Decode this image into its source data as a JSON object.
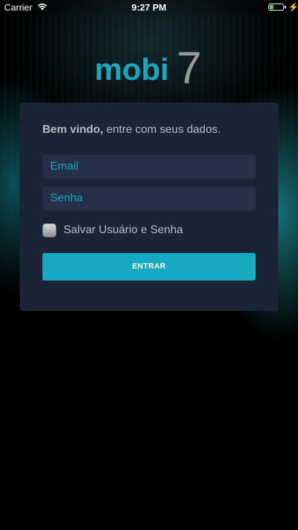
{
  "status_bar": {
    "carrier": "Carrier",
    "time": "9:27 PM",
    "battery_level": 0.3,
    "charging": true
  },
  "brand": {
    "logo_text": "mobi",
    "logo_number": "7",
    "teal_color": "#17a8c2",
    "grey_color": "#9a9a9a"
  },
  "login": {
    "welcome_bold": "Bem vindo,",
    "welcome_rest": " entre com seus dados.",
    "email_placeholder": "Email",
    "password_placeholder": "Senha",
    "remember_label": "Salvar Usuário e Senha",
    "remember_checked": false,
    "submit_label": "ENTRAR"
  },
  "colors": {
    "card_bg": "#1b2437",
    "field_bg": "#263047",
    "accent": "#17a8c2",
    "text": "#b6bcc8"
  },
  "icons": [
    "wifi-icon",
    "battery-icon",
    "charging-bolt-icon"
  ]
}
